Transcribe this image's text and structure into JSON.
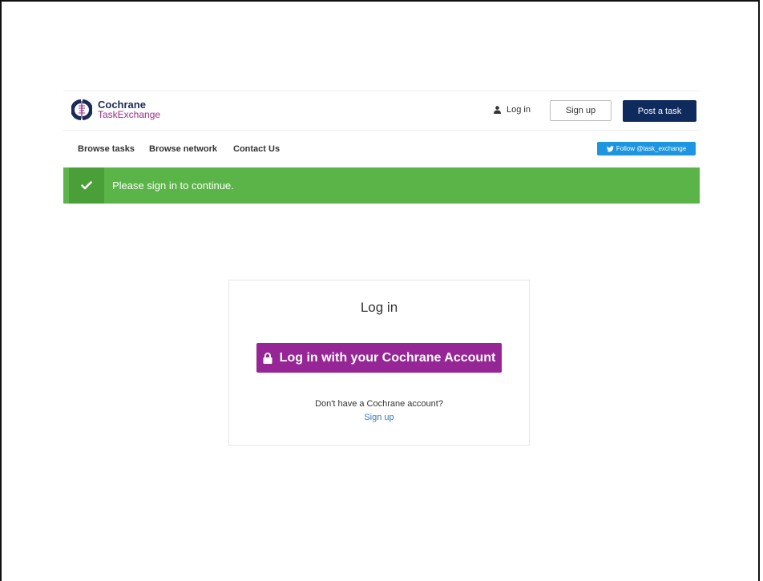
{
  "brand": {
    "line1": "Cochrane",
    "line2": "TaskExchange"
  },
  "header": {
    "login_label": "Log in",
    "signup_label": "Sign up",
    "post_task_label": "Post a task"
  },
  "nav": {
    "items": [
      {
        "label": "Browse tasks"
      },
      {
        "label": "Browse network"
      },
      {
        "label": "Contact Us"
      }
    ],
    "twitter_label": "Follow @task_exchange"
  },
  "alert": {
    "message": "Please sign in to continue."
  },
  "login_card": {
    "title": "Log in",
    "button_label": "Log in with your Cochrane Account",
    "prompt": "Don't have a Cochrane account?",
    "signup_link": "Sign up"
  },
  "colors": {
    "navy": "#0f2a5c",
    "purple": "#962595",
    "alert_green": "#5bb447",
    "twitter_blue": "#1d95e0",
    "link_blue": "#2f7bbf"
  }
}
